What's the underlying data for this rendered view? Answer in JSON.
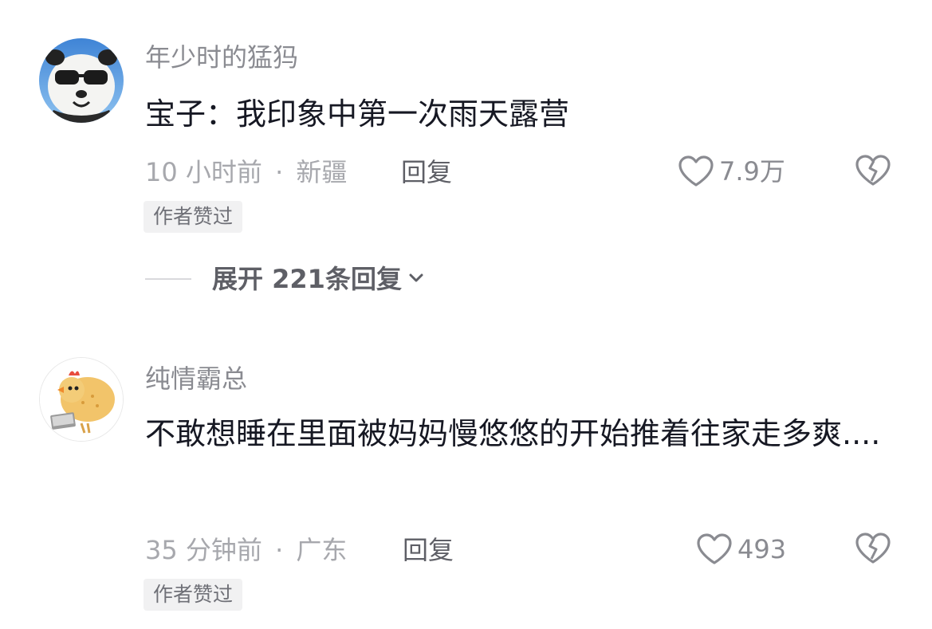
{
  "comments": [
    {
      "username": "年少时的猛犸",
      "avatar_icon": "panda-sunglasses-avatar",
      "text": "宝子：我印象中第一次雨天露营",
      "time": "10 小时前",
      "separator": "·",
      "location": "新疆",
      "reply_label": "回复",
      "likes": "7.9万",
      "badge": "作者赞过",
      "expand_label": "展开 221条回复"
    },
    {
      "username": "纯情霸总",
      "avatar_icon": "cartoon-chicken-avatar",
      "text": "不敢想睡在里面被妈妈慢悠悠的开始推着往家走多爽....",
      "time": "35 分钟前",
      "separator": "·",
      "location": "广东",
      "reply_label": "回复",
      "likes": "493",
      "badge": "作者赞过"
    }
  ],
  "colors": {
    "text_primary": "#161823",
    "text_secondary": "#8a8b91",
    "badge_bg": "#f1f1f2"
  }
}
